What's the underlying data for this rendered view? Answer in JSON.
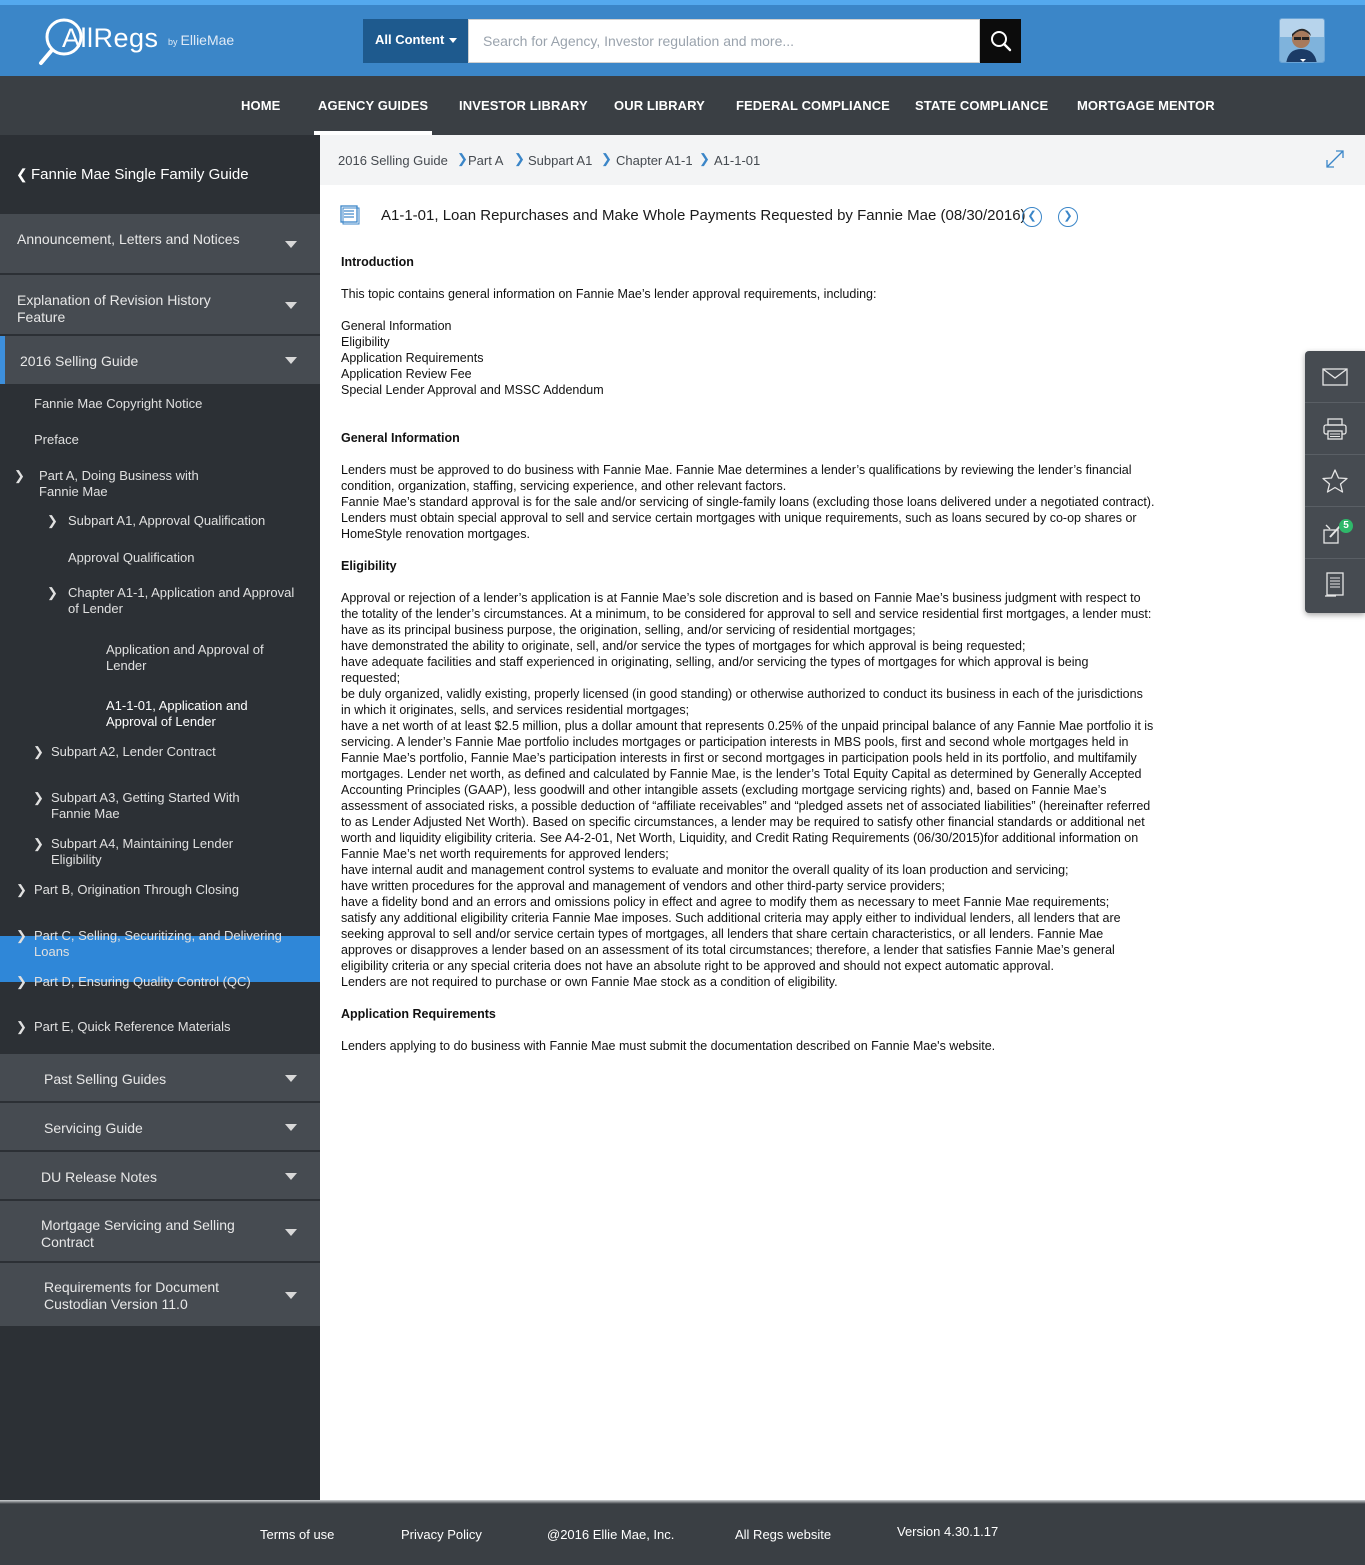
{
  "header": {
    "logo_text": "AllRegs",
    "logo_by_prefix": "by",
    "logo_by_brand": "EllieMae",
    "search_scope": "All Content",
    "search_placeholder": "Search for Agency, Investor regulation and more..."
  },
  "nav": {
    "items": [
      "HOME",
      "AGENCY GUIDES",
      "INVESTOR LIBRARY",
      "OUR LIBRARY",
      "FEDERAL COMPLIANCE",
      "STATE COMPLIANCE",
      "MORTGAGE MENTOR"
    ],
    "active": "AGENCY GUIDES"
  },
  "sidebar": {
    "back_label": "Fannie Mae Single Family Guide",
    "sections_top": [
      {
        "label": "Announcement, Letters and Notices"
      },
      {
        "label": "Explanation of Revision History Feature"
      },
      {
        "label": "2016 Selling Guide"
      }
    ],
    "tree": [
      "Fannie Mae Copyright Notice",
      "Preface",
      "Part A, Doing Business with Fannie Mae",
      "Subpart A1, Approval Qualification",
      "Approval Qualification",
      "Chapter A1-1, Application and Approval of Lender",
      "Application and Approval of Lender",
      "A1-1-01, Application and Approval of Lender",
      "Subpart A2, Lender Contract",
      "Subpart A3, Getting Started With Fannie Mae",
      "Subpart A4, Maintaining Lender Eligibility",
      "Part B, Origination Through Closing",
      "Part C, Selling, Securitizing, and Delivering Loans",
      "Part D, Ensuring Quality Control (QC)",
      "Part E, Quick Reference Materials"
    ],
    "sections_bottom": [
      {
        "label": "Past Selling Guides"
      },
      {
        "label": "Servicing Guide"
      },
      {
        "label": "DU Release Notes"
      },
      {
        "label": "Mortgage Servicing and Selling Contract"
      },
      {
        "label": "Requirements for Document Custodian Version 11.0"
      }
    ]
  },
  "breadcrumb": [
    "2016 Selling Guide",
    "Part A",
    "Subpart A1",
    "Chapter A1-1",
    "A1-1-01"
  ],
  "document": {
    "title": "A1-1-01, Loan Repurchases and Make Whole Payments Requested by Fannie Mae (08/30/2016)",
    "intro_heading": "Introduction",
    "intro_text": "This topic contains general information on Fannie Mae’s lender approval requirements, including:",
    "intro_list": [
      "General Information",
      "Eligibility",
      "Application Requirements",
      "Application Review Fee",
      "Special Lender Approval and MSSC Addendum"
    ],
    "general_heading": "General Information",
    "general_lines": [
      "Lenders must be approved to do business with Fannie Mae. Fannie Mae determines a lender’s qualifications by reviewing the lender’s financial",
      "condition, organization, staffing, servicing experience, and other relevant factors.",
      "Fannie Mae’s standard approval is for the sale and/or servicing of single-family loans (excluding those loans delivered under a negotiated contract).",
      "Lenders must obtain special approval to sell and service certain mortgages with unique requirements, such as loans secured by co-op shares or",
      "HomeStyle renovation mortgages."
    ],
    "eligibility_heading": "Eligibility",
    "eligibility_lines": [
      "Approval or rejection of a lender’s application is at Fannie Mae’s sole discretion and is based on Fannie Mae’s business judgment with respect to",
      "the totality of the lender’s circumstances. At a minimum, to be considered for approval to sell and service residential first mortgages, a lender must:",
      "have as its principal business purpose, the origination, selling, and/or servicing of residential mortgages;",
      "have demonstrated the ability to originate, sell, and/or service the types of mortgages for which approval is being requested;",
      "have adequate facilities and staff experienced in originating, selling, and/or servicing the types of mortgages for which approval is being",
      "requested;",
      "be duly organized, validly existing, properly licensed (in good standing) or otherwise authorized to conduct its business in each of the jurisdictions",
      "in which it originates, sells, and services residential mortgages;",
      "have a net worth of at least $2.5 million, plus a dollar amount that represents 0.25% of the unpaid principal balance of any Fannie Mae portfolio it is",
      "servicing. A lender’s Fannie Mae portfolio includes mortgages or participation interests in MBS pools, first and second whole mortgages held in",
      "Fannie Mae’s portfolio, Fannie Mae’s participation interests in first or second mortgages in participation pools held in its portfolio, and multifamily",
      "mortgages. Lender net worth, as defined and calculated by Fannie Mae, is the lender’s Total Equity Capital as determined by Generally Accepted",
      "Accounting Principles (GAAP), less goodwill and other intangible assets (excluding mortgage servicing rights) and, based on Fannie Mae’s",
      "assessment of associated risks, a possible deduction of “affiliate receivables” and “pledged assets net of associated liabilities” (hereinafter referred",
      "to as Lender Adjusted Net Worth). Based on specific circumstances, a lender may be required to satisfy other financial standards or additional net",
      "worth and liquidity eligibility criteria. See A4-2-01, Net Worth, Liquidity, and Credit Rating Requirements (06/30/2015)for additional information on",
      "Fannie Mae’s net worth requirements for approved lenders;",
      "have internal audit and management control systems to evaluate and monitor the overall quality of its loan production and servicing;",
      "have written procedures for the approval and management of vendors and other third-party service providers;",
      "have a fidelity bond and an errors and omissions policy in effect and agree to modify them as necessary to meet Fannie Mae requirements;",
      "satisfy any additional eligibility criteria Fannie Mae imposes. Such additional criteria may apply either to individual lenders, all lenders that are",
      "seeking approval to sell and/or service certain types of mortgages, all lenders that share certain characteristics, or all lenders. Fannie Mae",
      "approves or disapproves a lender based on an assessment of its total circumstances; therefore, a lender that satisfies Fannie Mae’s general",
      "eligibility criteria or any special criteria does not have an absolute right to be approved and should not expect automatic approval.",
      "Lenders are not required to purchase or own Fannie Mae stock as a condition of eligibility."
    ],
    "application_heading": "Application Requirements",
    "application_text": "Lenders applying to do business with Fannie Mae must submit the documentation described on Fannie Mae's website."
  },
  "tools": {
    "notification_count": "5"
  },
  "footer": {
    "items": [
      "Terms of use",
      "Privacy Policy",
      "@2016 Ellie Mae, Inc.",
      "All Regs website",
      "Version 4.30.1.17"
    ]
  }
}
